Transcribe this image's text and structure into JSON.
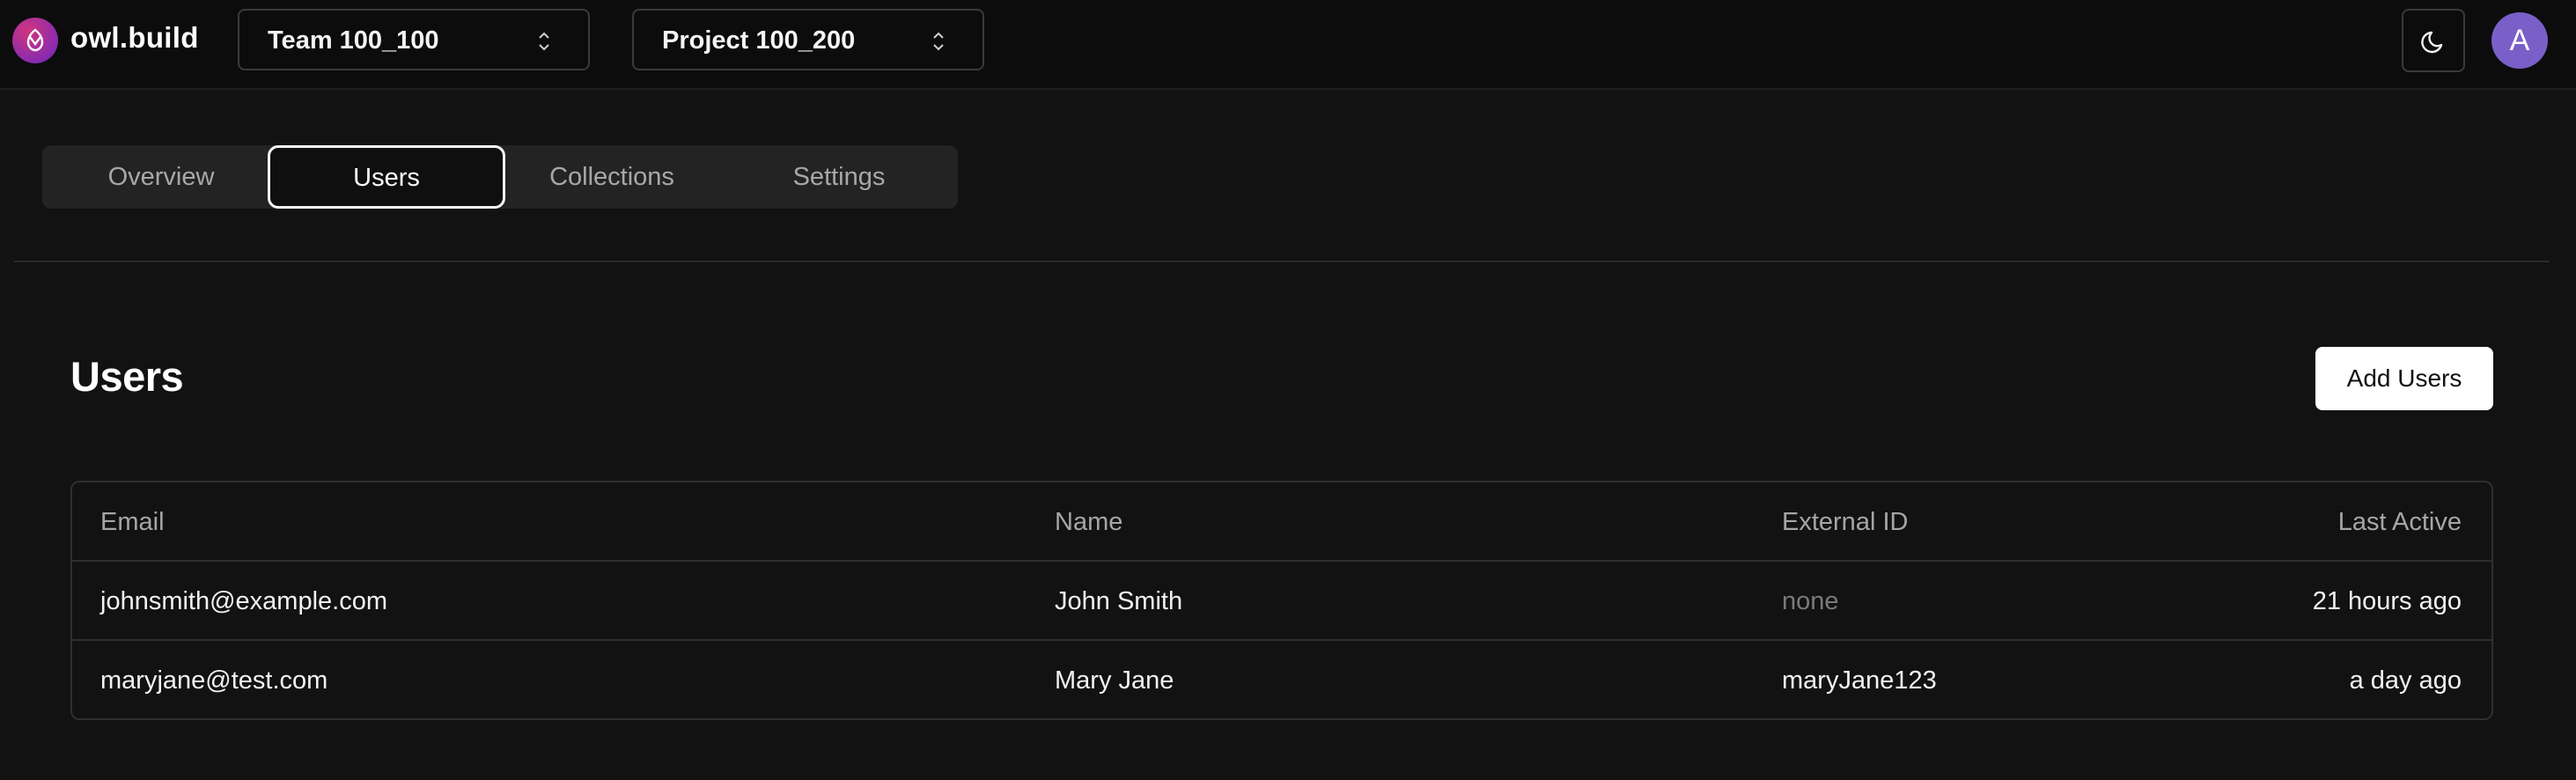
{
  "app": {
    "brand": "owl.build"
  },
  "header": {
    "team_select": "Team 100_100",
    "project_select": "Project 100_200",
    "avatar_initial": "A"
  },
  "tabs": [
    {
      "label": "Overview",
      "active": false
    },
    {
      "label": "Users",
      "active": true
    },
    {
      "label": "Collections",
      "active": false
    },
    {
      "label": "Settings",
      "active": false
    }
  ],
  "page": {
    "title": "Users",
    "add_button": "Add Users"
  },
  "table": {
    "columns": [
      "Email",
      "Name",
      "External ID",
      "Last Active"
    ],
    "rows": [
      {
        "email": "johnsmith@example.com",
        "name": "John Smith",
        "external_id": "none",
        "last_active": "21 hours ago"
      },
      {
        "email": "maryjane@test.com",
        "name": "Mary Jane",
        "external_id": "maryJane123",
        "last_active": "a day ago"
      }
    ]
  },
  "icons": {
    "logo": "owl-logo-icon",
    "select_chevron": "chevron-up-down-icon",
    "theme_toggle": "moon-icon"
  },
  "colors": {
    "accent_avatar": "#7a5fc9",
    "logo_gradient_start": "#d1357d",
    "logo_gradient_end": "#5a2a9a"
  }
}
